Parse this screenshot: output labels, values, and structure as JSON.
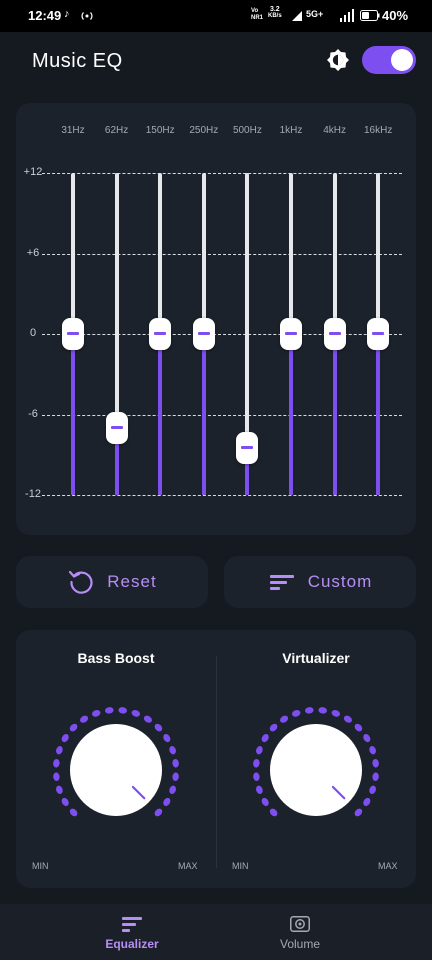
{
  "status_bar": {
    "time": "12:49",
    "volte_line1": "Vo",
    "volte_line2": "NR1",
    "net_speed_value": "3.2",
    "net_speed_unit": "KB/s",
    "network_type": "5G+",
    "battery": "40%"
  },
  "app_bar": {
    "title": "Music EQ",
    "brightness_icon": "brightness-auto-icon",
    "eq_enabled": true
  },
  "equalizer": {
    "db_labels": [
      "+12",
      "+6",
      "0",
      "-6",
      "-12"
    ],
    "db_min": -12,
    "db_max": 12,
    "bands": [
      {
        "freq": "31Hz",
        "gain_db": 0
      },
      {
        "freq": "62Hz",
        "gain_db": -7
      },
      {
        "freq": "150Hz",
        "gain_db": 0
      },
      {
        "freq": "250Hz",
        "gain_db": 0
      },
      {
        "freq": "500Hz",
        "gain_db": -8.5
      },
      {
        "freq": "1kHz",
        "gain_db": 0
      },
      {
        "freq": "4kHz",
        "gain_db": 0
      },
      {
        "freq": "16kHz",
        "gain_db": 0
      }
    ]
  },
  "actions": {
    "reset_label": "Reset",
    "reset_icon": "reset-icon",
    "preset_label": "Custom",
    "preset_icon": "preset-list-icon"
  },
  "effects": {
    "bass_boost": {
      "title": "Bass Boost",
      "min_label": "MIN",
      "max_label": "MAX",
      "level": 1.0
    },
    "virtualizer": {
      "title": "Virtualizer",
      "min_label": "MIN",
      "max_label": "MAX",
      "level": 1.0
    }
  },
  "bottom_nav": {
    "items": [
      {
        "label": "Equalizer",
        "icon": "equalizer-icon",
        "active": true
      },
      {
        "label": "Volume",
        "icon": "speaker-icon",
        "active": false
      }
    ]
  },
  "colors": {
    "accent": "#7d4ff0",
    "accent_light": "#b68ef5",
    "background": "#151a21",
    "panel": "#1c222b"
  }
}
